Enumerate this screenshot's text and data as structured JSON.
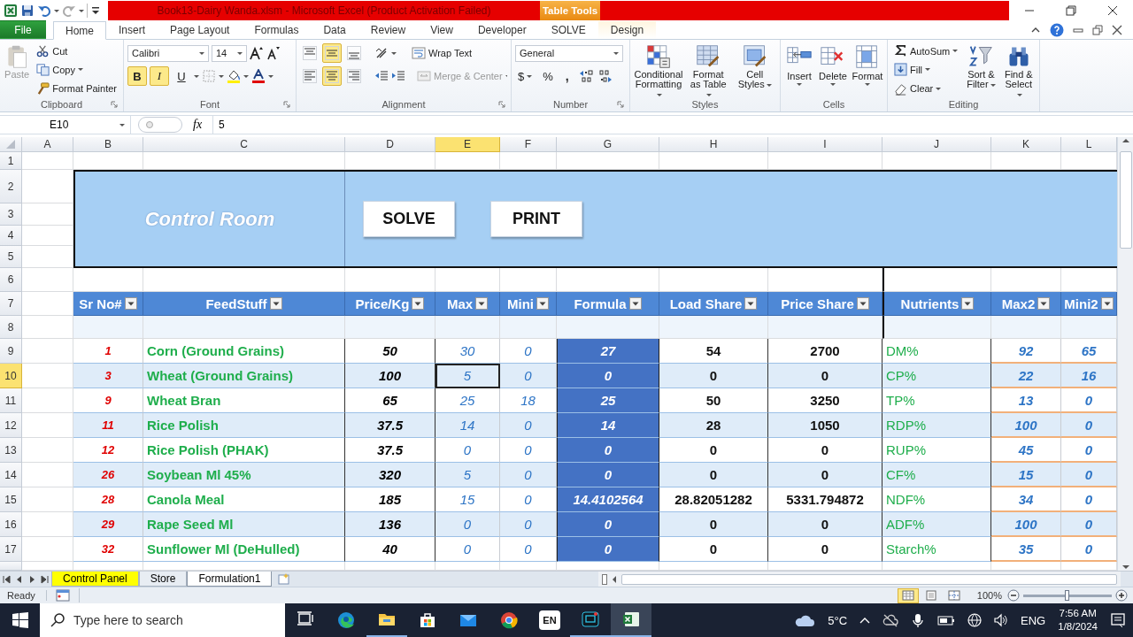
{
  "window": {
    "title": "Book13-Dairy Wanda.xlsm - Microsoft Excel (Product Activation Failed)",
    "context_tab": "Table Tools"
  },
  "ribbon_tabs": [
    {
      "label": "File",
      "kind": "file",
      "selected": false
    },
    {
      "label": "Home",
      "kind": "tab",
      "selected": true
    },
    {
      "label": "Insert",
      "kind": "tab",
      "selected": false
    },
    {
      "label": "Page Layout",
      "kind": "tab",
      "selected": false
    },
    {
      "label": "Formulas",
      "kind": "tab",
      "selected": false
    },
    {
      "label": "Data",
      "kind": "tab",
      "selected": false
    },
    {
      "label": "Review",
      "kind": "tab",
      "selected": false
    },
    {
      "label": "View",
      "kind": "tab",
      "selected": false
    },
    {
      "label": "Developer",
      "kind": "tab",
      "selected": false
    },
    {
      "label": "SOLVE",
      "kind": "tab",
      "selected": false
    },
    {
      "label": "Design",
      "kind": "context",
      "selected": false
    }
  ],
  "ribbon": {
    "clipboard": {
      "label": "Clipboard",
      "paste": {
        "label": "Paste",
        "disabled": true
      },
      "cut": "Cut",
      "copy": "Copy",
      "format_painter": "Format Painter"
    },
    "font": {
      "label": "Font",
      "name": "Calibri",
      "size": "14",
      "bold": {
        "label": "B",
        "on": true
      },
      "italic": {
        "label": "I",
        "on": true
      },
      "underline": {
        "label": "U",
        "on": false
      }
    },
    "alignment": {
      "label": "Alignment",
      "vertical_align": [
        {
          "on": false
        },
        {
          "on": true
        },
        {
          "on": false
        }
      ],
      "horizontal_align": [
        {
          "on": false
        },
        {
          "on": true
        },
        {
          "on": false
        }
      ],
      "wrap_text": "Wrap Text",
      "merge_center": {
        "label": "Merge & Center",
        "disabled": true
      }
    },
    "number": {
      "label": "Number",
      "format": "General",
      "currency": "$",
      "percent": "%",
      "comma": ","
    },
    "styles": {
      "label": "Styles",
      "buttons": [
        "Conditional Formatting",
        "Format as Table",
        "Cell Styles"
      ]
    },
    "cells": {
      "label": "Cells",
      "buttons": [
        "Insert",
        "Delete",
        "Format"
      ]
    },
    "editing": {
      "label": "Editing",
      "autosum": "AutoSum",
      "fill": "Fill",
      "clear": "Clear",
      "buttons": [
        "Sort & Filter",
        "Find & Select"
      ]
    }
  },
  "formula_bar": {
    "name_box": "E10",
    "function_label": "fx",
    "value": "5"
  },
  "sheet": {
    "columns": [
      {
        "label": "A",
        "selected": false
      },
      {
        "label": "B",
        "selected": false
      },
      {
        "label": "C",
        "selected": false
      },
      {
        "label": "D",
        "selected": false
      },
      {
        "label": "E",
        "selected": true
      },
      {
        "label": "F",
        "selected": false
      },
      {
        "label": "G",
        "selected": false
      },
      {
        "label": "H",
        "selected": false
      },
      {
        "label": "I",
        "selected": false
      },
      {
        "label": "J",
        "selected": false
      },
      {
        "label": "K",
        "selected": false
      },
      {
        "label": "L",
        "selected": false
      }
    ],
    "rows": [
      {
        "label": "1",
        "selected": false
      },
      {
        "label": "2",
        "selected": false
      },
      {
        "label": "3",
        "selected": false
      },
      {
        "label": "4",
        "selected": false
      },
      {
        "label": "5",
        "selected": false
      },
      {
        "label": "6",
        "selected": false
      },
      {
        "label": "7",
        "selected": false
      },
      {
        "label": "8",
        "selected": false
      },
      {
        "label": "9",
        "selected": false
      },
      {
        "label": "10",
        "selected": true
      },
      {
        "label": "11",
        "selected": false
      },
      {
        "label": "12",
        "selected": false
      },
      {
        "label": "13",
        "selected": false
      },
      {
        "label": "14",
        "selected": false
      },
      {
        "label": "15",
        "selected": false
      },
      {
        "label": "16",
        "selected": false
      },
      {
        "label": "17",
        "selected": false
      }
    ],
    "banner": {
      "title": "Control Room",
      "buttons": [
        "SOLVE",
        "PRINT"
      ]
    },
    "table": {
      "columns": [
        "Sr No#",
        "FeedStuff",
        "Price/Kg",
        "Max",
        "Mini",
        "Formula",
        "Load Share",
        "Price Share",
        "Nutrients",
        "Max2",
        "Mini2"
      ],
      "rows": [
        {
          "cells": [
            "1",
            "Corn (Ground Grains)",
            "50",
            "30",
            "0",
            "27",
            "54",
            "2700",
            "DM%",
            "92",
            "65"
          ]
        },
        {
          "cells": [
            "3",
            "Wheat (Ground Grains)",
            "100",
            "5",
            "0",
            "0",
            "0",
            "0",
            "CP%",
            "22",
            "16"
          ]
        },
        {
          "cells": [
            "9",
            "Wheat Bran",
            "65",
            "25",
            "18",
            "25",
            "50",
            "3250",
            "TP%",
            "13",
            "0"
          ]
        },
        {
          "cells": [
            "11",
            "Rice Polish",
            "37.5",
            "14",
            "0",
            "14",
            "28",
            "1050",
            "RDP%",
            "100",
            "0"
          ]
        },
        {
          "cells": [
            "12",
            "Rice Polish (PHAK)",
            "37.5",
            "0",
            "0",
            "0",
            "0",
            "0",
            "RUP%",
            "45",
            "0"
          ]
        },
        {
          "cells": [
            "26",
            "Soybean Ml 45%",
            "320",
            "5",
            "0",
            "0",
            "0",
            "0",
            "CF%",
            "15",
            "0"
          ]
        },
        {
          "cells": [
            "28",
            "Canola Meal",
            "185",
            "15",
            "0",
            "14.4102564",
            "28.82051282",
            "5331.794872",
            "NDF%",
            "34",
            "0"
          ]
        },
        {
          "cells": [
            "29",
            "Rape Seed Ml",
            "136",
            "0",
            "0",
            "0",
            "0",
            "0",
            "ADF%",
            "100",
            "0"
          ]
        },
        {
          "cells": [
            "32",
            "Sunflower Ml (DeHulled)",
            "40",
            "0",
            "0",
            "0",
            "0",
            "0",
            "Starch%",
            "35",
            "0"
          ]
        }
      ]
    }
  },
  "sheet_tabs": [
    {
      "label": "Control Panel",
      "selected": false,
      "color": "#ffff00"
    },
    {
      "label": "Store",
      "selected": false
    },
    {
      "label": "Formulation1",
      "selected": true
    }
  ],
  "status_bar": {
    "status": "Ready",
    "view_buttons": [
      {
        "selected": true
      },
      {
        "selected": false
      },
      {
        "selected": false
      }
    ],
    "zoom": "100%",
    "zoom_slider": {
      "level": 0.5
    }
  },
  "taskbar": {
    "search_placeholder": "Type here to search",
    "apps": [
      {
        "kind": "task-view",
        "running": false
      },
      {
        "kind": "edge",
        "running": false
      },
      {
        "kind": "explorer",
        "running": true
      },
      {
        "kind": "store",
        "running": false
      },
      {
        "kind": "mail",
        "running": false
      },
      {
        "kind": "chrome",
        "running": false
      },
      {
        "kind": "en",
        "label": "EN",
        "running": false
      },
      {
        "kind": "recorder",
        "running": true
      },
      {
        "kind": "excel",
        "running": true
      }
    ],
    "weather": "5°C",
    "language": "ENG",
    "time": "7:56 AM",
    "date": "1/8/2024"
  }
}
